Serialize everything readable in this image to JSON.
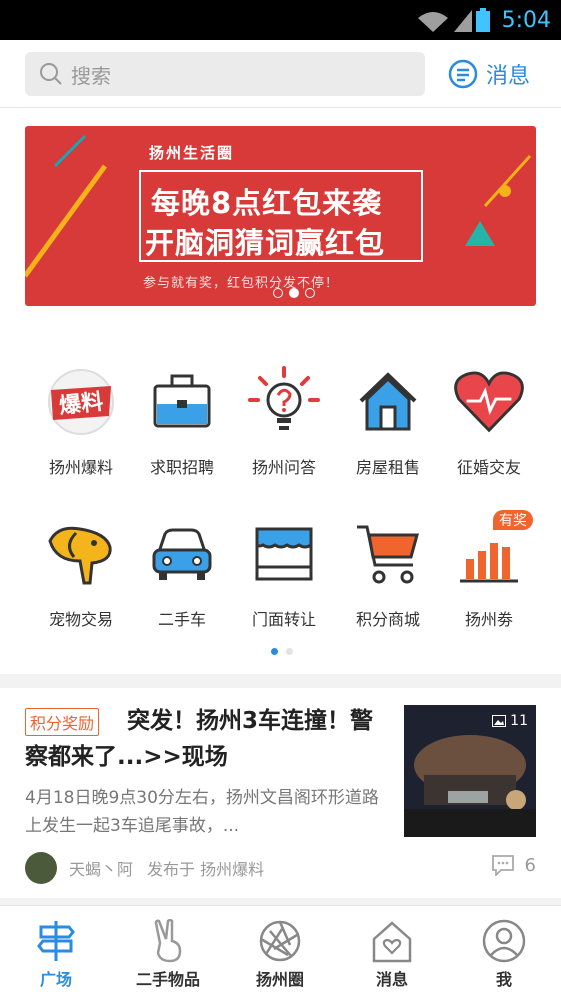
{
  "status": {
    "time": "5:04"
  },
  "header": {
    "search_placeholder": "搜索",
    "messages_label": "消息"
  },
  "banner": {
    "brand": "扬州生活圈",
    "line1": "每晚8点红包来袭",
    "line2": "开脑洞猜词赢红包",
    "subtitle": "参与就有奖，红包积分发不停！"
  },
  "categories": [
    {
      "label": "扬州爆料",
      "icon": "baoliao-icon",
      "icon_text": "爆料"
    },
    {
      "label": "求职招聘",
      "icon": "briefcase-icon"
    },
    {
      "label": "扬州问答",
      "icon": "question-bulb-icon"
    },
    {
      "label": "房屋租售",
      "icon": "house-icon"
    },
    {
      "label": "征婚交友",
      "icon": "heart-icon"
    },
    {
      "label": "宠物交易",
      "icon": "dog-icon"
    },
    {
      "label": "二手车",
      "icon": "car-icon"
    },
    {
      "label": "门面转让",
      "icon": "storefront-icon"
    },
    {
      "label": "积分商城",
      "icon": "cart-icon"
    },
    {
      "label": "扬州劵",
      "icon": "bar-chart-icon",
      "badge": "有奖"
    }
  ],
  "feed": {
    "badge": "积分奖励",
    "title": "突发！扬州3车连撞！警察都来了...>>现场",
    "description": "4月18日晚9点30分左右，扬州文昌阁环形道路上发生一起3车追尾事故，...",
    "image_count": "11",
    "author": "天蝎丶阿",
    "posted_in": "发布于 扬州爆料",
    "comment_count": "6"
  },
  "tabs": [
    {
      "label": "广场",
      "icon": "signpost-icon",
      "active": true
    },
    {
      "label": "二手物品",
      "icon": "peace-hand-icon"
    },
    {
      "label": "扬州圈",
      "icon": "aperture-icon"
    },
    {
      "label": "消息",
      "icon": "heart-house-icon"
    },
    {
      "label": "我",
      "icon": "user-icon"
    }
  ],
  "colors": {
    "accent": "#2a8be0",
    "banner_red": "#d73a38",
    "badge_orange": "#f0642d"
  }
}
